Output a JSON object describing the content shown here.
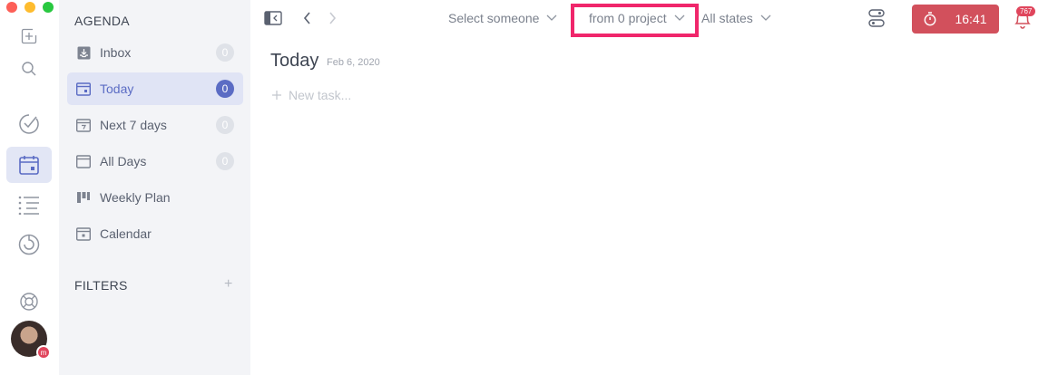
{
  "sidebar": {
    "agenda_title": "AGENDA",
    "items": [
      {
        "label": "Inbox",
        "count": "0"
      },
      {
        "label": "Today",
        "count": "0"
      },
      {
        "label": "Next 7 days",
        "count": "0"
      },
      {
        "label": "All Days",
        "count": "0"
      },
      {
        "label": "Weekly Plan"
      },
      {
        "label": "Calendar"
      }
    ],
    "filters_title": "FILTERS",
    "filters_add": "+"
  },
  "toolbar": {
    "person_filter": "Select someone",
    "project_filter": "from 0 project",
    "state_filter": "All states",
    "timer": "16:41",
    "notifications": "767"
  },
  "main": {
    "title": "Today",
    "date": "Feb 6, 2020",
    "new_task_placeholder": "New task..."
  },
  "colors": {
    "accent": "#5b6cc4",
    "timer_bg": "#d2505c",
    "highlight_border": "#f0266b"
  },
  "icons": [
    "add-task-icon",
    "search-icon",
    "check-circle-icon",
    "calendar-icon",
    "list-icon",
    "stats-icon",
    "lifebuoy-icon"
  ]
}
